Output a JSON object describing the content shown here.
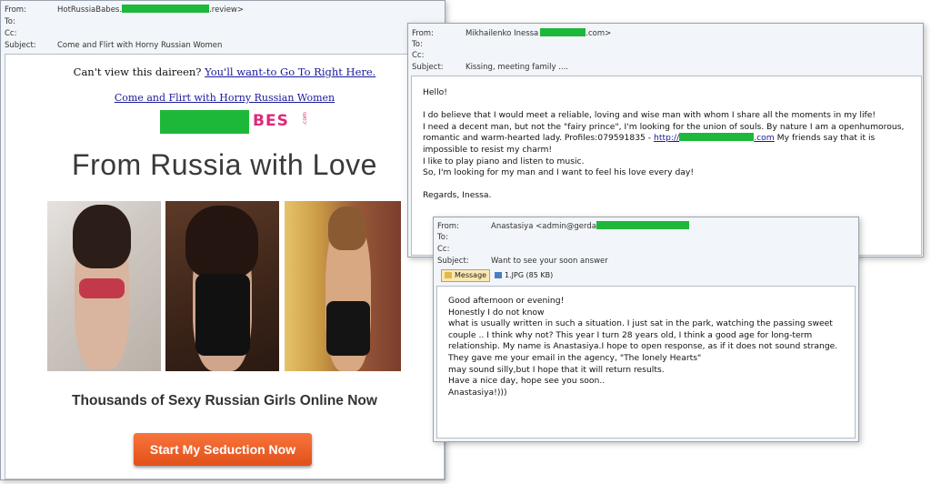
{
  "email1": {
    "header": {
      "from_label": "From:",
      "from_prefix": "HotRussiaBabes.",
      "from_suffix": ".review>",
      "to_label": "To:",
      "cc_label": "Cc:",
      "subject_label": "Subject:",
      "subject": "Come and Flirt with Horny Russian Women"
    },
    "cant_view": "Can't view this daireen?",
    "cant_view_link": "You'll want-to Go To Right Here.",
    "promo_link": "Come and Flirt with Horny Russian Women",
    "logo_text": "BES",
    "logo_small": ".com",
    "headline": "From Russia with Love",
    "subheadline": "Thousands of Sexy Russian Girls Online Now",
    "cta_label": "Start My Seduction Now"
  },
  "email2": {
    "header": {
      "from_label": "From:",
      "from_prefix": "Mikhailenko Inessa",
      "from_suffix": ".com>",
      "to_label": "To:",
      "cc_label": "Cc:",
      "subject_label": "Subject:",
      "subject": "Kissing, meeting family ...."
    },
    "greeting": "Hello!",
    "p1": "I do believe that I would meet a reliable, loving and wise man with whom I share all the moments in my life!",
    "p2a": "I need a decent man, but not the \"fairy prince\", I'm looking for the union of souls. By nature I am a openhumorous, romantic and warm-hearted lady. Profiles:079591835 - ",
    "p2_link_prefix": "http://",
    "p2_link_suffix": ".com",
    "p2b": " My friends say that it is impossible to resist my charm!",
    "p3": "I like to play piano and listen to music.",
    "p4": "So, I'm looking for my man and I want to feel his love every day!",
    "sign": "Regards, Inessa."
  },
  "email3": {
    "header": {
      "from_label": "From:",
      "from_prefix": "Anastasiya <admin@gerda",
      "to_label": "To:",
      "cc_label": "Cc:",
      "subject_label": "Subject:",
      "subject": "Want to see your soon answer"
    },
    "tab_message": "Message",
    "attachment": "1.JPG (85 KB)",
    "body": "Good afternoon or evening!\nHonestly I do not know\nwhat is usually written in such a situation. I just sat in the park, watching the passing sweet couple .. I think why not? This year I turn 28 years old, I think a good age for long-term relationship. My name is Anastasiya.I hope to open response, as if it does not sound strange.\nThey gave me your email in the agency, \"The lonely Hearts\"\nmay sound silly,but I hope that it will return results.\nHave a nice day, hope see you soon..\nAnastasiya!)))"
  }
}
